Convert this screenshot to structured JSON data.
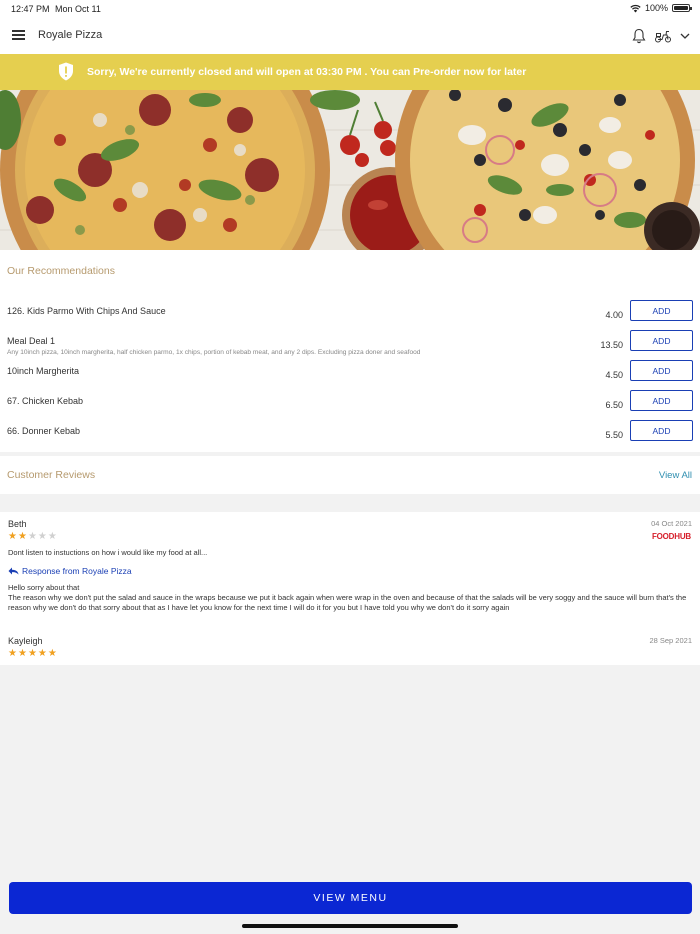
{
  "status_bar": {
    "time": "12:47 PM",
    "date": "Mon Oct 11",
    "battery": "100%"
  },
  "nav": {
    "title": "Royale Pizza",
    "icons": [
      "menu-icon",
      "bell-icon",
      "scooter-icon",
      "chevron-down-icon"
    ]
  },
  "banner": {
    "message": "Sorry, We're currently closed and will open at 03:30 PM . You can Pre-order now for later",
    "icon": "shield-alert-icon",
    "color": "#e5cf4f"
  },
  "recommendations": {
    "title": "Our Recommendations",
    "add_label": "ADD",
    "items": [
      {
        "name": "126. Kids Parmo With Chips And Sauce",
        "description": "",
        "price": "4.00"
      },
      {
        "name": "Meal Deal 1",
        "description": "Any 10inch pizza, 10inch margherita, half chicken parmo, 1x chips, portion of kebab meat,  and any 2 dips. Excluding pizza doner and seafood",
        "price": "13.50"
      },
      {
        "name": "10inch Margherita",
        "description": "",
        "price": "4.50"
      },
      {
        "name": "67. Chicken Kebab",
        "description": "",
        "price": "6.50"
      },
      {
        "name": "66. Donner Kebab",
        "description": "",
        "price": "5.50"
      }
    ]
  },
  "reviews": {
    "title": "Customer Reviews",
    "view_all": "View All",
    "items": [
      {
        "name": "Beth",
        "date": "04 Oct 2021",
        "rating": 2,
        "text": "Dont listen to instuctions on how i would like my food at all...",
        "source": "FOODHUB",
        "response_label": "Response from Royale Pizza",
        "response_text": "Hello sorry about that\nThe reason why we don't put the salad and sauce in the wraps because we put it back again when were wrap in the oven and because of that the salads will be very soggy and the sauce will burn that's the reason why we don't do that sorry about that as I have let you know for the next time I will do it for you but I have told you why we don't do it sorry again"
      },
      {
        "name": "Kayleigh",
        "date": "28 Sep 2021",
        "rating": 5
      }
    ]
  },
  "footer": {
    "view_menu": "VIEW MENU",
    "accent": "#0b27d3"
  }
}
